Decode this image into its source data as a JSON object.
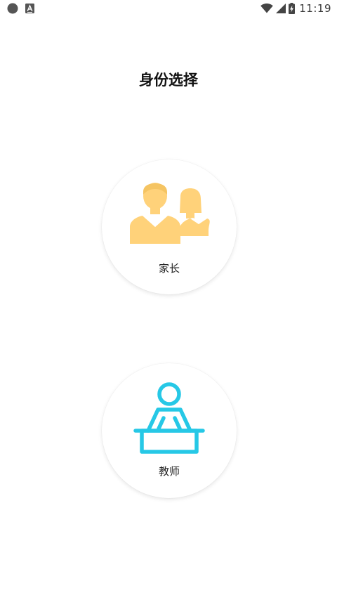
{
  "status_bar": {
    "time": "11:19",
    "left_icons": [
      "circle-notification-icon",
      "font-app-icon"
    ],
    "right_icons": [
      "wifi-icon",
      "cell-signal-icon",
      "battery-charging-icon"
    ]
  },
  "page": {
    "title": "身份选择"
  },
  "roles": [
    {
      "id": "parent",
      "label": "家长",
      "icon": "parents-icon",
      "color": "#FFD27A"
    },
    {
      "id": "teacher",
      "label": "教师",
      "icon": "teacher-podium-icon",
      "color": "#26C8E6"
    }
  ]
}
